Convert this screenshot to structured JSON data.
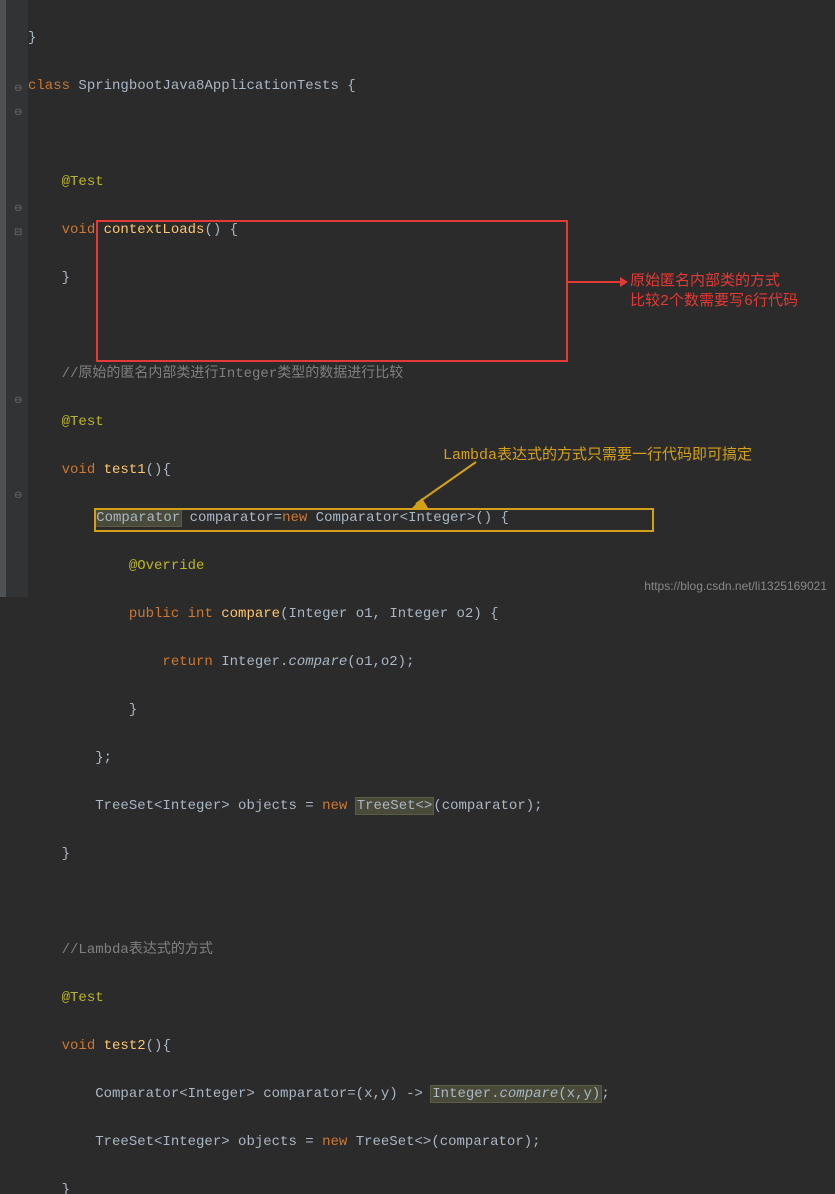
{
  "code": {
    "l1_brace": "}",
    "l2": "class SpringbootJava8ApplicationTests {",
    "l3": "",
    "l4": "    @Test",
    "l5_void": "    void ",
    "l5_name": "contextLoads",
    "l5_rest": "() {",
    "l6": "    }",
    "l7": "",
    "l8": "    //原始的匿名内部类进行Integer类型的数据进行比较",
    "l9": "    @Test",
    "l10_void": "    void ",
    "l10_name": "test1",
    "l10_rest": "(){",
    "l11": "        Comparator comparator=new Comparator<Integer>() {",
    "l12": "            @Override",
    "l13": "            public int compare(Integer o1, Integer o2) {",
    "l14": "                return Integer.compare(o1,o2);",
    "l15": "            }",
    "l16": "        };",
    "l17": "        TreeSet<Integer> objects = new TreeSet<>(comparator);",
    "l18": "    }",
    "l19": "",
    "l20": "    //Lambda表达式的方式",
    "l21": "    @Test",
    "l22_void": "    void ",
    "l22_name": "test2",
    "l22_rest": "(){",
    "l23": "        Comparator<Integer> comparator=(x,y) -> Integer.compare(x,y);",
    "l24": "        TreeSet<Integer> objects = new TreeSet<>(comparator);",
    "l25": "    }"
  },
  "annotation_red_line1": "原始匿名内部类的方式",
  "annotation_red_line2": "比较2个数需要写6行代码",
  "annotation_yellow": "Lambda表达式的方式只需要一行代码即可搞定",
  "watermark": "https://blog.csdn.net/li1325169021"
}
